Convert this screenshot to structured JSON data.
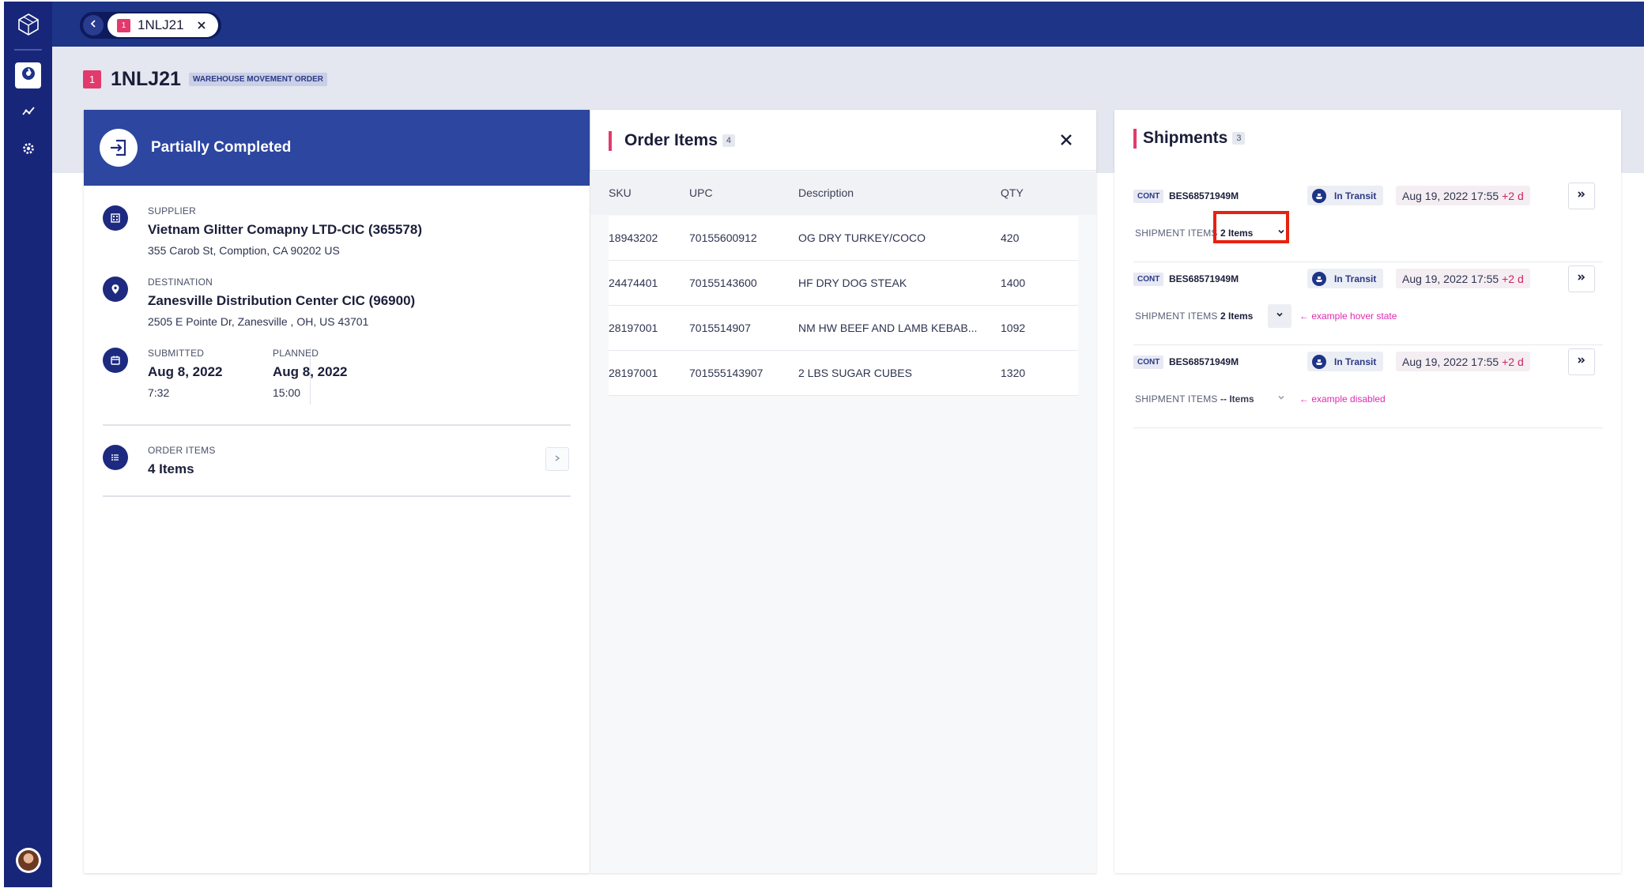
{
  "tab": {
    "number": "1",
    "label": "1NLJ21"
  },
  "page": {
    "number": "1",
    "title": "1NLJ21",
    "type_tag": "WAREHOUSE MOVEMENT ORDER"
  },
  "status": {
    "label": "Partially Completed"
  },
  "supplier": {
    "label": "SUPPLIER",
    "name": "Vietnam Glitter Comapny LTD-CIC (365578)",
    "address": "355 Carob St, Comption, CA 90202 US"
  },
  "destination": {
    "label": "DESTINATION",
    "name": "Zanesville Distribution Center CIC (96900)",
    "address": "2505 E Pointe Dr, Zanesville , OH, US 43701"
  },
  "dates": {
    "submitted_label": "SUBMITTED",
    "submitted_date": "Aug 8, 2022",
    "submitted_time": "7:32",
    "planned_label": "PLANNED",
    "planned_date": "Aug 8, 2022",
    "planned_time": "15:00"
  },
  "order_items_summary": {
    "label": "ORDER ITEMS",
    "value": "4 Items"
  },
  "order_items": {
    "title": "Order Items",
    "count": "4",
    "columns": [
      "SKU",
      "UPC",
      "Description",
      "QTY"
    ],
    "rows": [
      [
        "18943202",
        "70155600912",
        "OG DRY TURKEY/COCO",
        "420"
      ],
      [
        "24474401",
        "70155143600",
        "HF DRY DOG STEAK",
        "1400"
      ],
      [
        "28197001",
        "7015514907",
        "NM HW BEEF AND LAMB KEBAB...",
        "1092"
      ],
      [
        "28197001",
        "701555143907",
        "2 LBS SUGAR CUBES",
        "1320"
      ]
    ]
  },
  "shipments": {
    "title": "Shipments",
    "count": "3",
    "items_label": "SHIPMENT ITEMS",
    "rows": [
      {
        "tag": "CONT",
        "id": "BES68571949M",
        "status": "In Transit",
        "eta": "Aug 19, 2022 17:55",
        "delay": "+2 d",
        "items": "2 Items",
        "note": ""
      },
      {
        "tag": "CONT",
        "id": "BES68571949M",
        "status": "In Transit",
        "eta": "Aug 19, 2022 17:55",
        "delay": "+2 d",
        "items": "2 Items",
        "note": "← example hover state"
      },
      {
        "tag": "CONT",
        "id": "BES68571949M",
        "status": "In Transit",
        "eta": "Aug 19, 2022 17:55",
        "delay": "+2 d",
        "items": "-- Items",
        "note": "← example disabled"
      }
    ]
  },
  "colors": {
    "sidebar": "#18267a",
    "topbar": "#1d3487",
    "status_head": "#2d46a0",
    "accent": "#e23a6c",
    "note": "#e02bb1",
    "highlight": "#e62210"
  },
  "icons": [
    "app-logo-icon",
    "dashboard-icon",
    "analytics-icon",
    "settings-icon",
    "chevron-left-icon",
    "close-icon",
    "entry-arrow-icon",
    "building-icon",
    "location-pin-icon",
    "calendar-icon",
    "list-icon",
    "chevron-right-icon",
    "ship-icon",
    "double-chevron-right-icon",
    "chevron-down-icon"
  ]
}
